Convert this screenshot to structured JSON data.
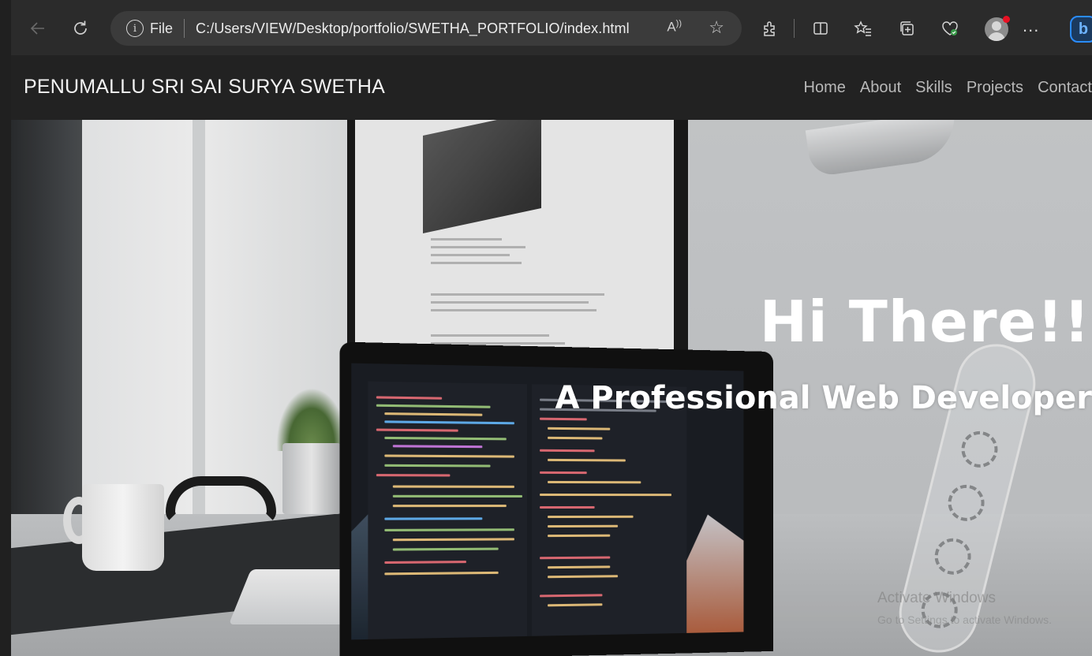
{
  "browser": {
    "file_label": "File",
    "url": "C:/Users/VIEW/Desktop/portfolio/SWETHA_PORTFOLIO/index.html",
    "read_aloud": "A¸",
    "icons": [
      "back-icon",
      "refresh-icon",
      "info-icon",
      "read-aloud-icon",
      "favorite-star-icon",
      "extensions-icon",
      "split-screen-icon",
      "favorites-icon",
      "collections-icon",
      "health-icon",
      "profile-avatar",
      "more-icon",
      "bing-copilot-icon"
    ],
    "more": "..."
  },
  "site": {
    "brand": "PENUMALLU SRI SAI SURYA SWETHA",
    "menu": [
      "Home",
      "About",
      "Skills",
      "Projects",
      "Contact"
    ]
  },
  "hero": {
    "title": "Hi There!!",
    "subtitle": "A Professional Web Developer"
  },
  "watermark": {
    "line1": "Activate Windows",
    "line2": "Go to Settings to activate Windows."
  },
  "colors": {
    "chrome_bg": "#2b2b2b",
    "navbar_bg": "#222222",
    "menu_text": "#b8b8b8",
    "hero_text": "#ffffff",
    "accent": "#2a8cff"
  }
}
